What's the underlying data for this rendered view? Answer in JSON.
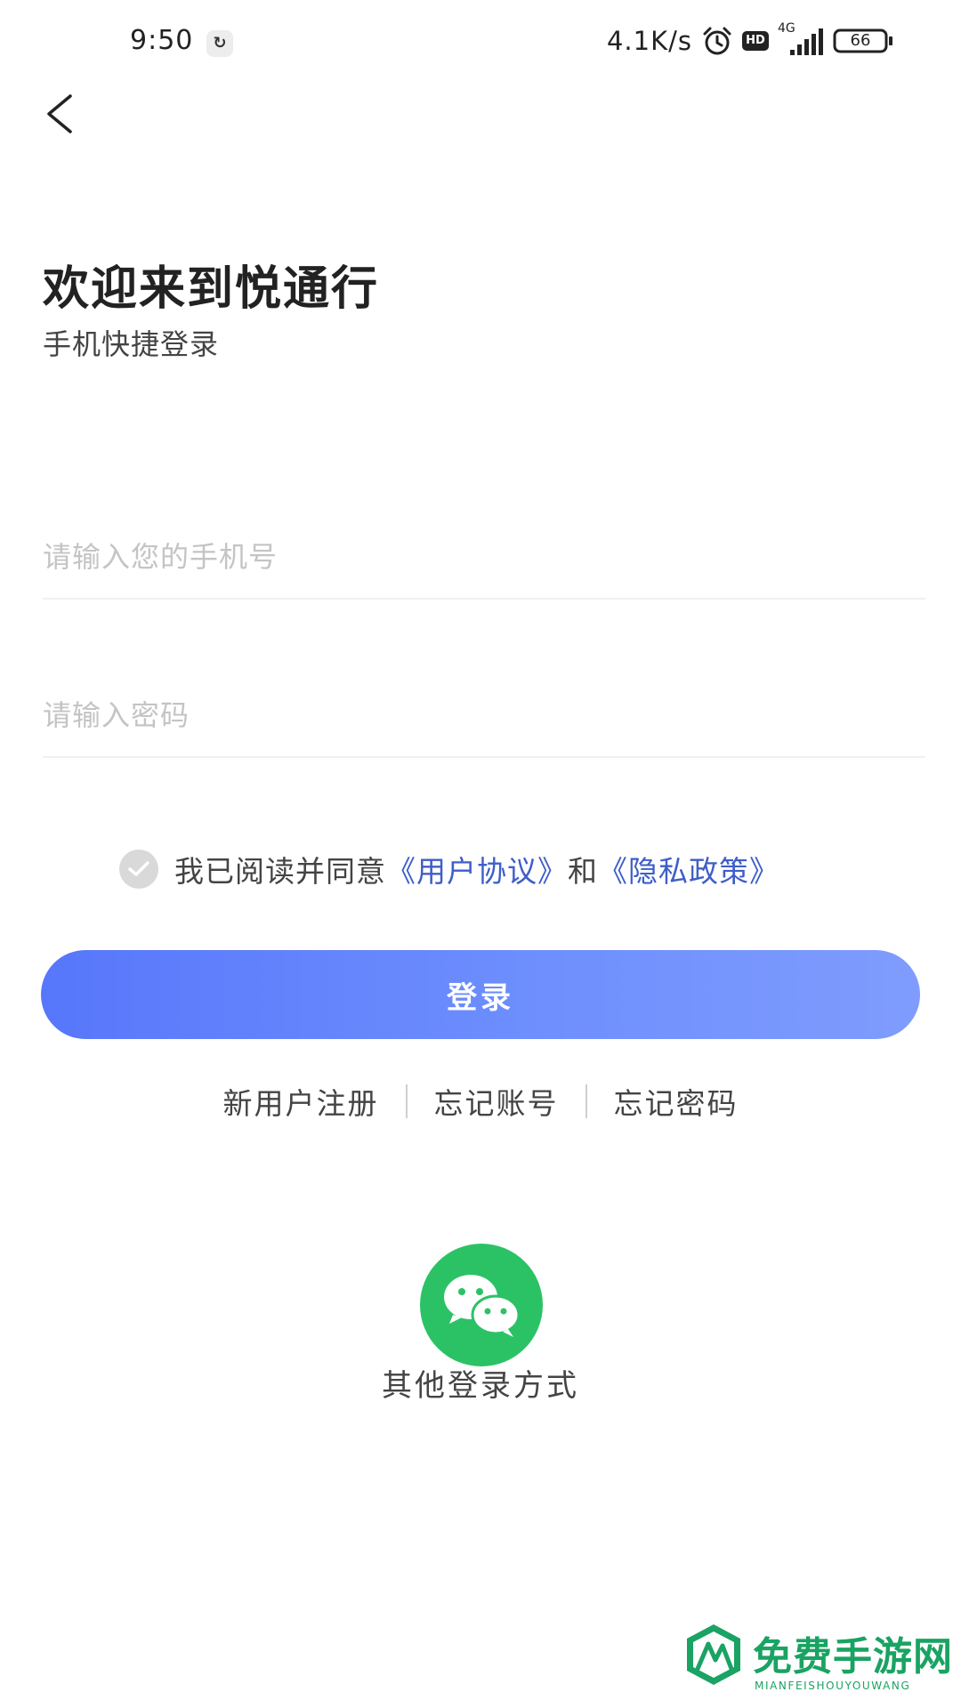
{
  "status_bar": {
    "time": "9:50",
    "net_speed": "4.1K/s",
    "hd_badge": "HD",
    "network_type": "4G",
    "battery": "66"
  },
  "header": {
    "back_icon": "chevron-left-icon"
  },
  "welcome": {
    "title": "欢迎来到悦通行",
    "subtitle": "手机快捷登录"
  },
  "form": {
    "phone_placeholder": "请输入您的手机号",
    "phone_value": "",
    "password_placeholder": "请输入密码",
    "password_value": ""
  },
  "agreement": {
    "checked": true,
    "prefix": "我已阅读并同意",
    "user_agreement": "《用户协议》",
    "and": "和",
    "privacy_policy": "《隐私政策》"
  },
  "login_button": {
    "label": "登录"
  },
  "links": {
    "register": "新用户注册",
    "forgot_account": "忘记账号",
    "forgot_password": "忘记密码"
  },
  "other_login": {
    "icon": "wechat-icon",
    "label": "其他登录方式"
  },
  "watermark": {
    "title": "免费手游网",
    "subtitle": "MIANFEISHOUYOUWANG"
  },
  "colors": {
    "primary": "#5b7cfb",
    "link": "#3e5ec9",
    "wechat": "#2bc265",
    "watermark": "#1aa363"
  }
}
